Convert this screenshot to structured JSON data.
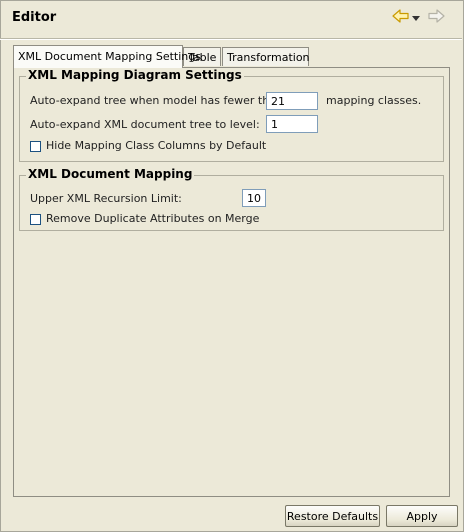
{
  "header": {
    "title": "Editor",
    "back_icon": "back-arrow-icon",
    "dropdown_icon": "chevron-down-icon",
    "forward_icon": "forward-arrow-icon",
    "nav_color": "#e8b400"
  },
  "tabs": [
    {
      "label": "XML Document Mapping Settings",
      "active": true
    },
    {
      "label": "Table",
      "active": false
    },
    {
      "label": "Transformation",
      "active": false
    }
  ],
  "diagram_settings": {
    "title": "XML Mapping Diagram Settings",
    "autoexpand_model_label": "Auto-expand tree when model has fewer than",
    "autoexpand_model_value": "21",
    "autoexpand_model_suffix": "mapping classes.",
    "autoexpand_xml_label": "Auto-expand XML document tree to level:",
    "autoexpand_xml_value": "1",
    "hide_columns_label": "Hide Mapping Class Columns by Default",
    "hide_columns_checked": false
  },
  "document_mapping": {
    "title": "XML Document Mapping",
    "recursion_label": "Upper XML Recursion Limit:",
    "recursion_value": "10",
    "remove_duplicates_label": "Remove Duplicate Attributes on Merge",
    "remove_duplicates_checked": false
  },
  "buttons": {
    "restore_defaults": "Restore Defaults",
    "apply": "Apply"
  }
}
